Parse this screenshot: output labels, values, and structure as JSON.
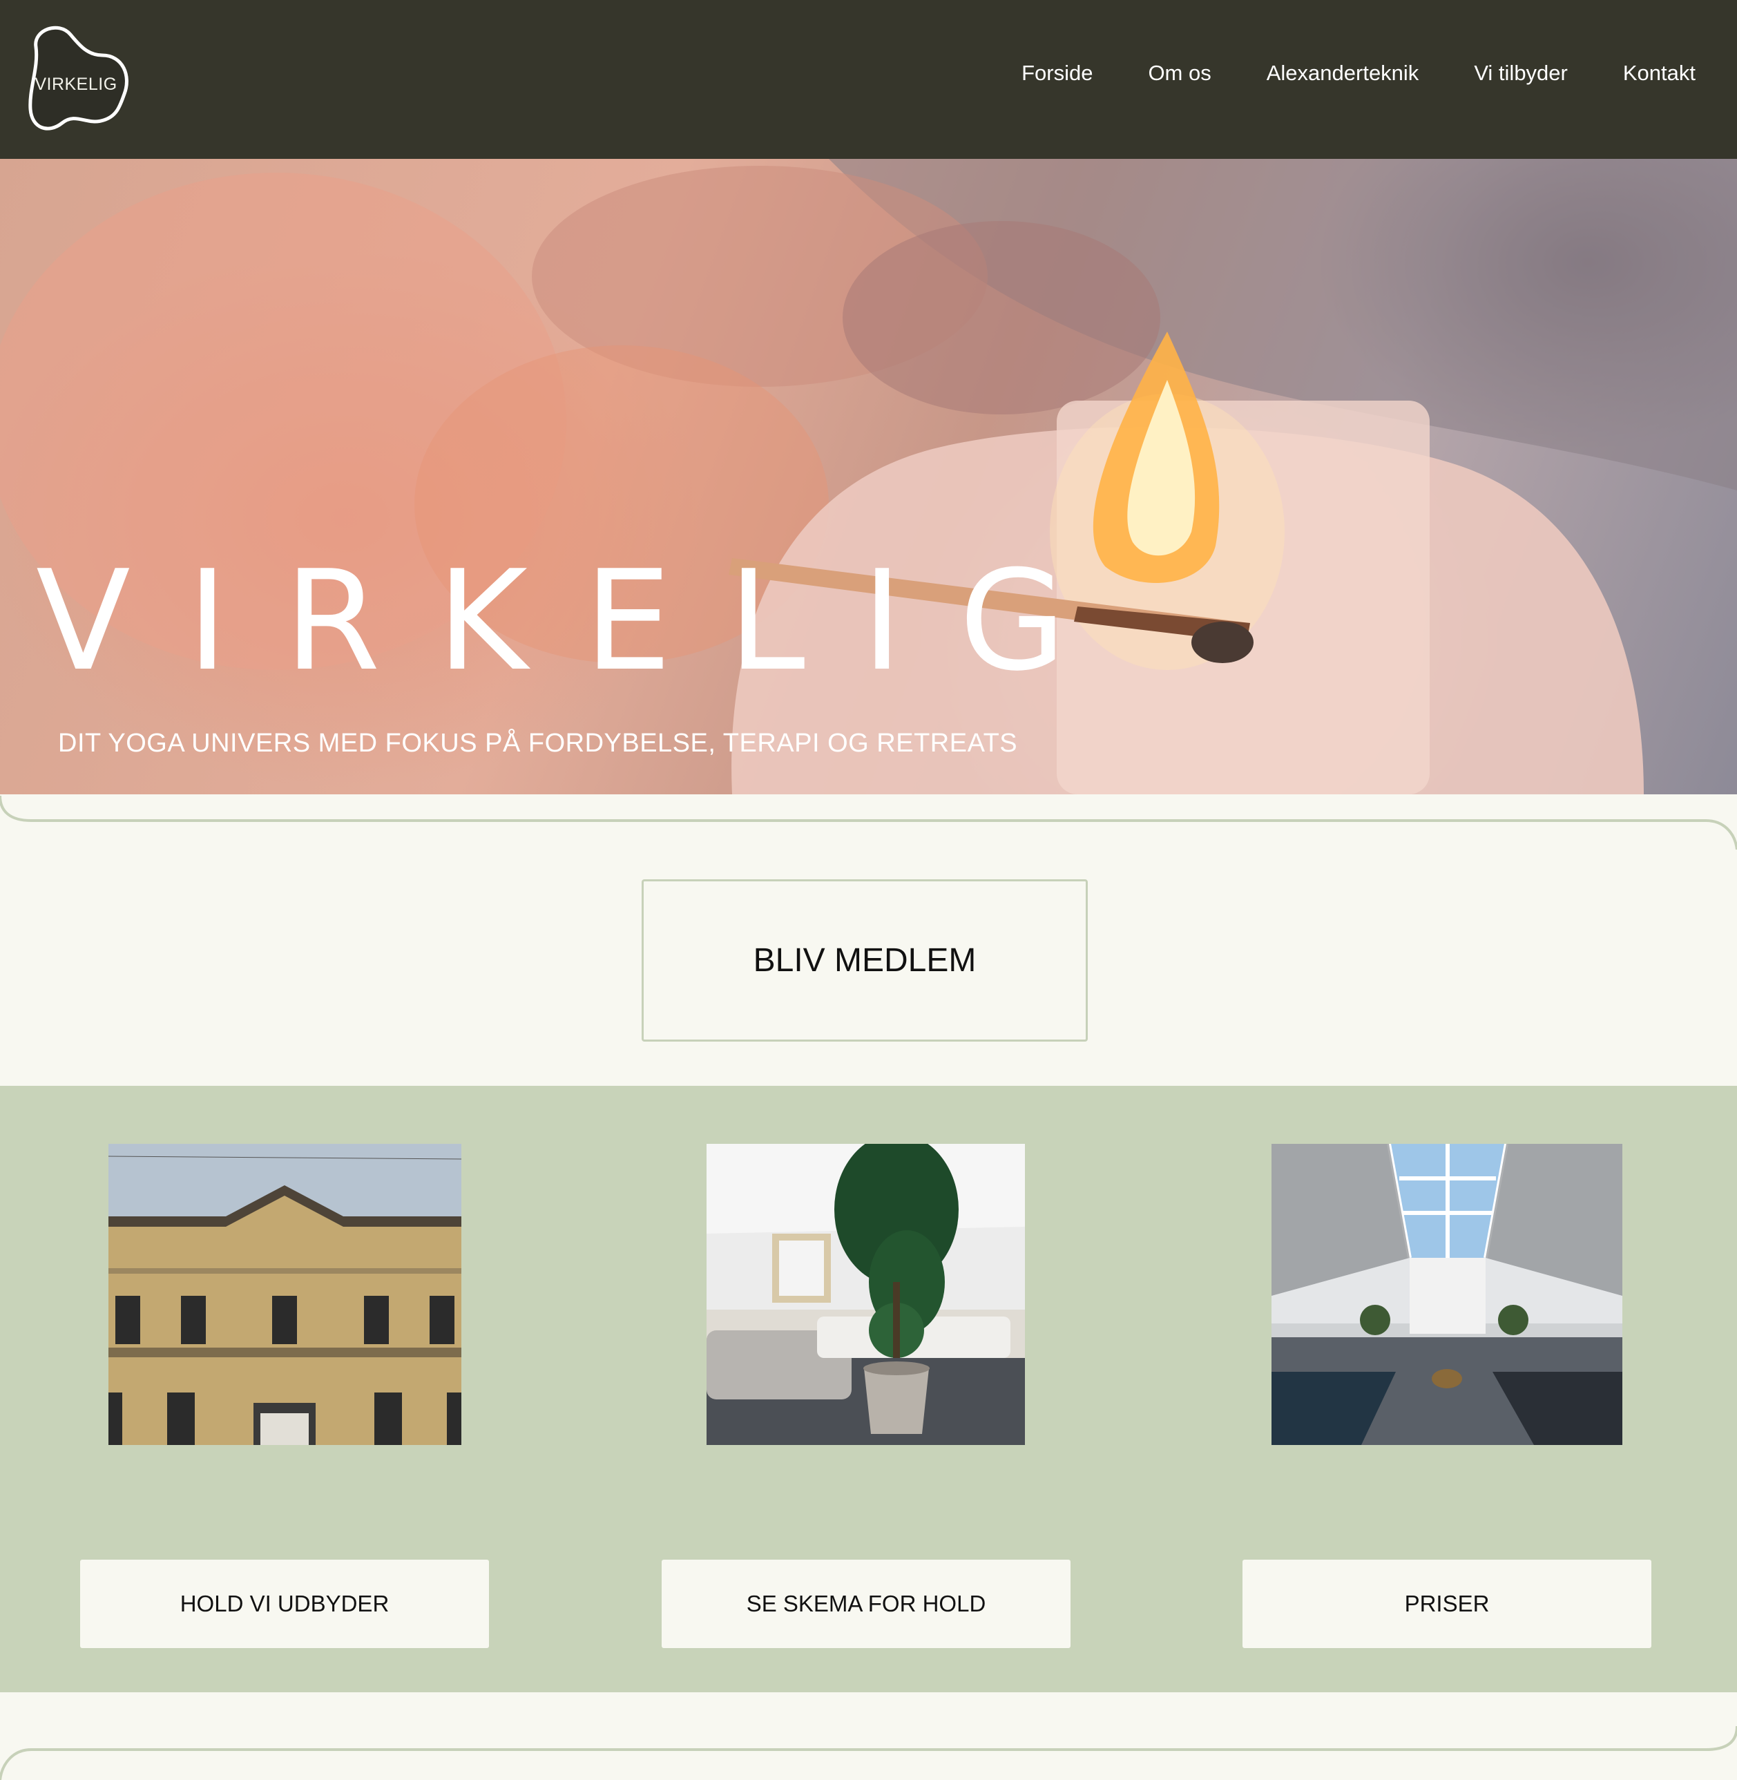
{
  "header": {
    "logo_text": "VIRKELIG",
    "nav": [
      "Forside",
      "Om os",
      "Alexanderteknik",
      "Vi tilbyder",
      "Kontakt"
    ]
  },
  "hero": {
    "title": "VIRKELIG",
    "subtitle": "DIT YOGA UNIVERS MED FOKUS PÅ FORDYBELSE, TERAPI OG RETREATS"
  },
  "membership": {
    "button_label": "BLIV MEDLEM"
  },
  "features": [
    {
      "button_label": "HOLD VI UDBYDER"
    },
    {
      "button_label": "SE SKEMA FOR HOLD"
    },
    {
      "button_label": "PRISER"
    }
  ],
  "colors": {
    "header_bg": "#36362b",
    "page_bg": "#f8f8f1",
    "section_green": "#c8d3b9",
    "outline_green": "#c7d1b9"
  }
}
